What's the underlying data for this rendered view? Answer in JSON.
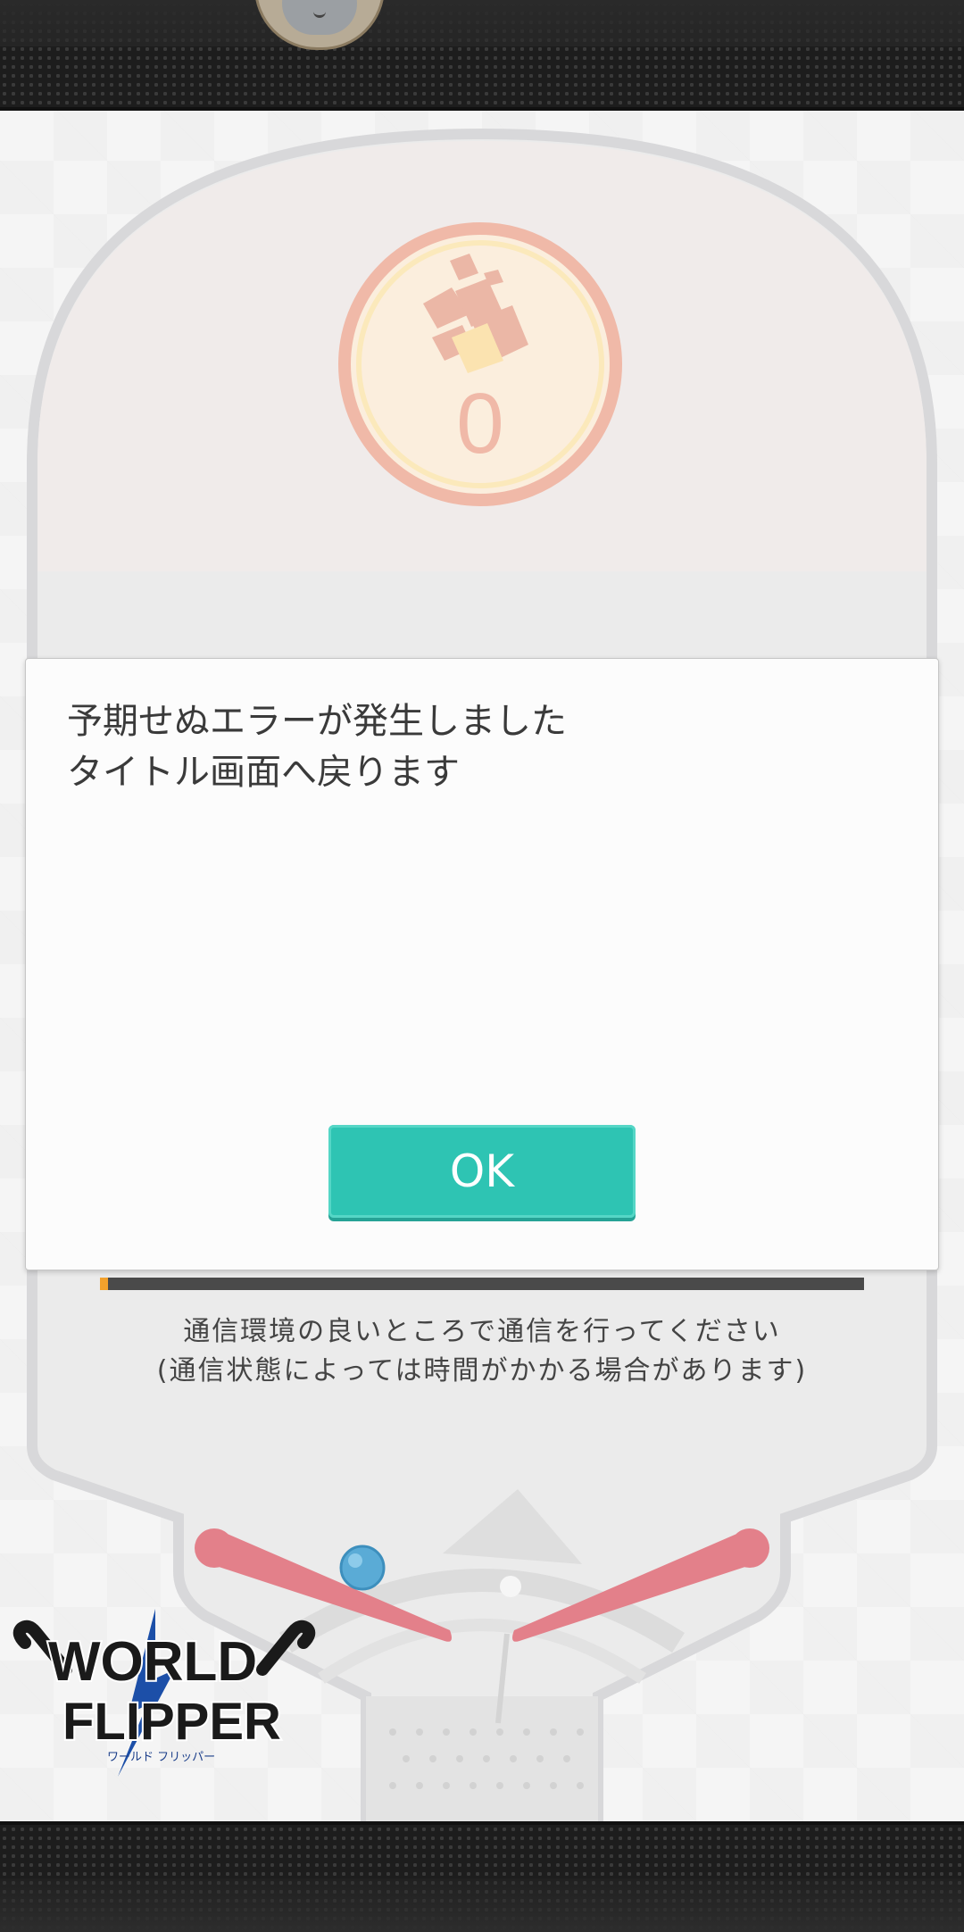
{
  "counter": {
    "value": "0"
  },
  "dialog": {
    "message": "予期せぬエラーが発生しました\nタイトル画面へ戻ります",
    "ok_label": "OK"
  },
  "loading": {
    "progress_percent": 1,
    "notice_line1": "通信環境の良いところで通信を行ってください",
    "notice_line2": "(通信状態によっては時間がかかる場合があります)"
  },
  "logo": {
    "line1": "WORLD",
    "line2": "FLIPPER",
    "kana": "ワールド フリッパー"
  },
  "colors": {
    "ok_button": "#2ec4b3",
    "progress_fill": "#f2a12c",
    "flipper": "#e3808a",
    "ball": "#5aabd6",
    "counter_ring": "#f0b9a8"
  }
}
